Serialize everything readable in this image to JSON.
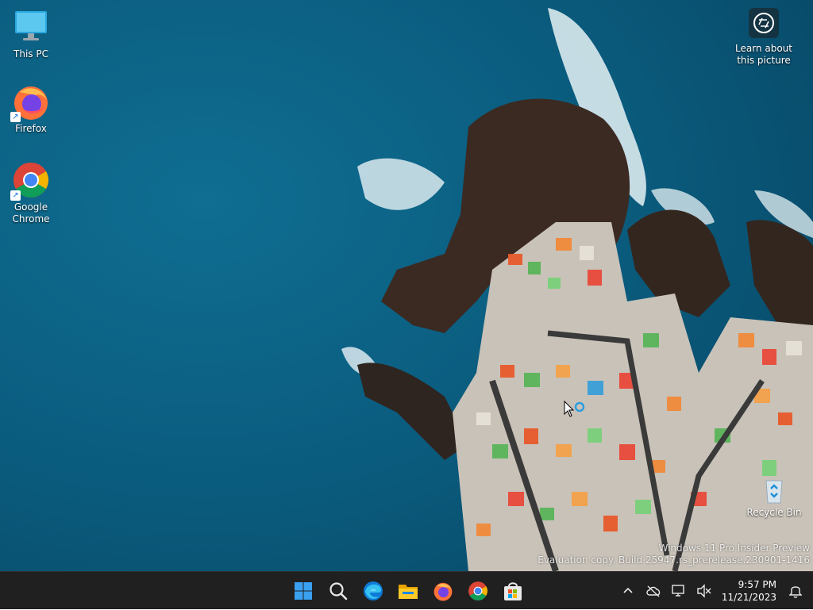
{
  "desktop": {
    "icons": [
      {
        "label": "This PC",
        "icon": "computer-icon"
      },
      {
        "label": "Firefox",
        "icon": "firefox-icon"
      },
      {
        "label": "Google Chrome",
        "icon": "chrome-icon"
      },
      {
        "label": "Recycle Bin",
        "icon": "recycle-bin-icon"
      }
    ],
    "learn_about": {
      "label_line1": "Learn about",
      "label_line2": "this picture",
      "icon": "camera-info-icon"
    },
    "watermark": {
      "line1": "Windows 11 Pro Insider Preview",
      "line2": "Evaluation copy. Build 25947.rs_prerelease.230901-1416"
    }
  },
  "taskbar": {
    "apps": [
      {
        "name": "Start",
        "icon": "windows-start-icon"
      },
      {
        "name": "Search",
        "icon": "search-icon"
      },
      {
        "name": "Microsoft Edge",
        "icon": "edge-icon"
      },
      {
        "name": "File Explorer",
        "icon": "file-explorer-icon"
      },
      {
        "name": "Firefox",
        "icon": "firefox-icon"
      },
      {
        "name": "Google Chrome",
        "icon": "chrome-icon"
      },
      {
        "name": "Microsoft Store",
        "icon": "store-icon"
      }
    ],
    "tray": {
      "icons": [
        "chevron-up-icon",
        "cloud-offline-icon",
        "network-icon",
        "volume-muted-icon"
      ],
      "time": "9:57 PM",
      "date": "11/21/2023",
      "notification_icon": "bell-icon"
    }
  },
  "colors": {
    "taskbar_bg": "#202020",
    "sea": "#0b5f80",
    "accent": "#0078d4"
  }
}
